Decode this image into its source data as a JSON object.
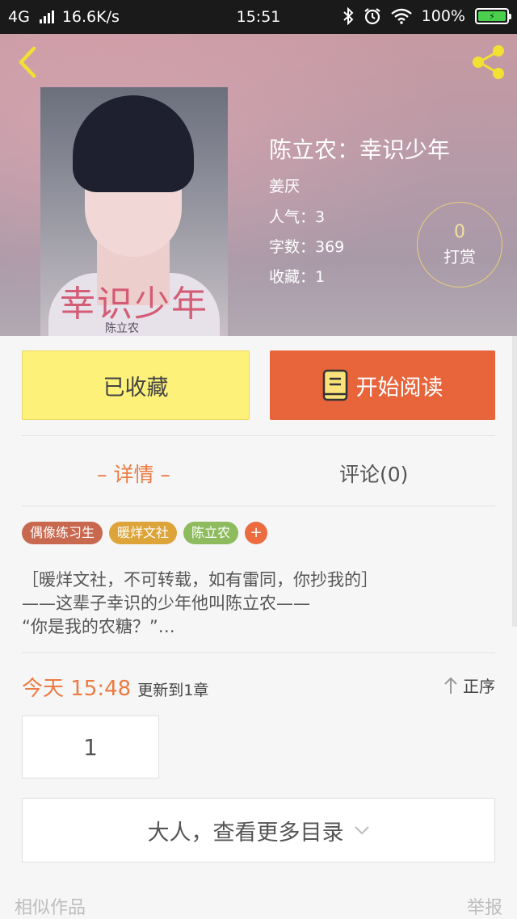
{
  "status_bar": {
    "network": "4G",
    "speed": "16.6K/s",
    "time": "15:51",
    "battery": "100%"
  },
  "book": {
    "title": "陈立农：幸识少年",
    "author": "姜厌",
    "popularity": "人气：3",
    "word_count": "字数：369",
    "favorites": "收藏：1",
    "cover_title": "幸识少年",
    "cover_author": "陈立农"
  },
  "reward": {
    "count": "0",
    "label": "打赏"
  },
  "actions": {
    "favorited_label": "已收藏",
    "read_label": "开始阅读"
  },
  "tabs": {
    "detail": "– 详情 –",
    "comments": "评论(0)"
  },
  "tags": [
    {
      "label": "偶像练习生",
      "color": "#c8684f"
    },
    {
      "label": "暖烊文社",
      "color": "#dda43a"
    },
    {
      "label": "陈立农",
      "color": "#8dbb5e"
    }
  ],
  "tag_add": "+",
  "tag_add_color": "#ec6c3f",
  "description": {
    "line1": "［暖烊文社，不可转载，如有雷同，你抄我的］",
    "line2": "——这辈子幸识的少年他叫陈立农——",
    "line3": "“你是我的农糖？”…"
  },
  "update": {
    "day_time": "今天 15:48",
    "text": "更新到1章",
    "sort_label": "正序"
  },
  "chapter": {
    "number": "1"
  },
  "more_catalog": "大人，查看更多目录",
  "footer": {
    "similar": "相似作品",
    "report": "举报"
  },
  "colors": {
    "accent": "#e8643b",
    "favorite_bg": "#fdf17a",
    "header_icon": "#f2e033"
  },
  "icons": [
    "back-arrow-icon",
    "share-icon",
    "book-icon",
    "sort-up-arrow-icon",
    "chevron-down-icon",
    "bluetooth-icon",
    "alarm-icon",
    "wifi-icon",
    "battery-icon"
  ]
}
